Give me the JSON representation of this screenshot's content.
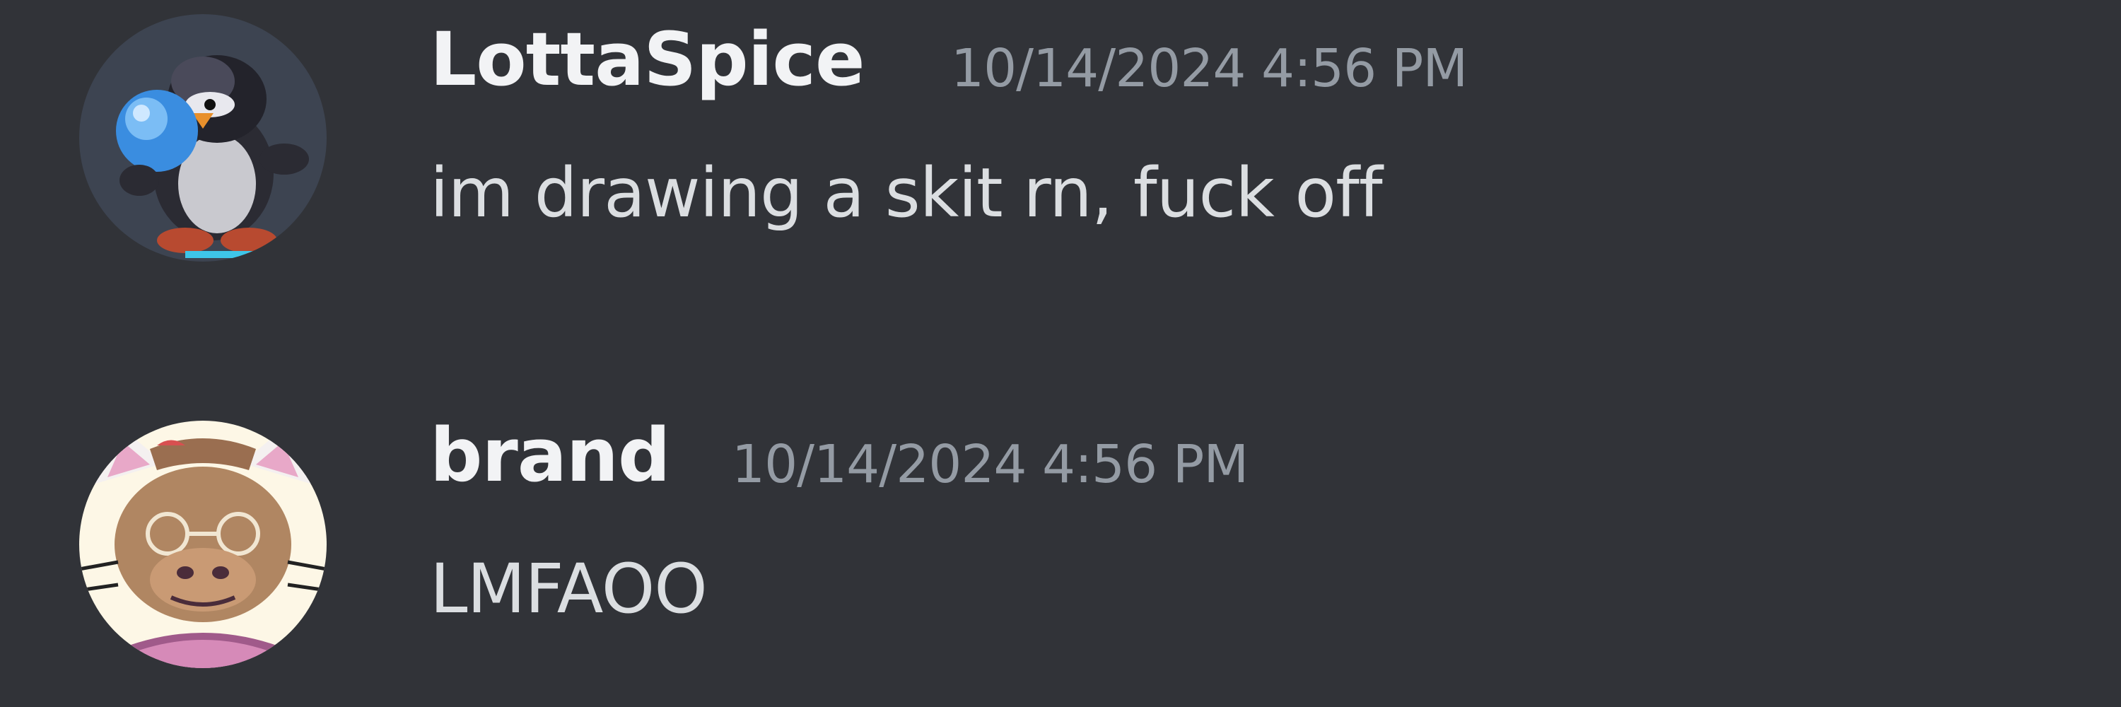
{
  "messages": [
    {
      "author": "LottaSpice",
      "timestamp": "10/14/2024 4:56 PM",
      "content": "im drawing a skit rn, fuck off",
      "avatar": "penguin-avatar"
    },
    {
      "author": "brand",
      "timestamp": "10/14/2024 4:56 PM",
      "content": "LMFAOO",
      "avatar": "cat-avatar"
    }
  ],
  "colors": {
    "background": "#313338",
    "username": "#f2f3f5",
    "timestamp": "#949ba4",
    "message_text": "#dbdee1"
  }
}
